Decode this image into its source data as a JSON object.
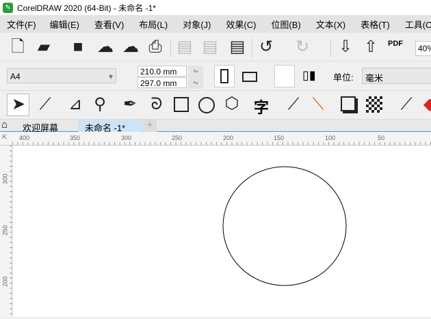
{
  "window": {
    "title": "CorelDRAW 2020 (64-Bit) - 未命名 -1*"
  },
  "menu": [
    "文件(F)",
    "编辑(E)",
    "查看(V)",
    "布局(L)",
    "对象(J)",
    "效果(C)",
    "位图(B)",
    "文本(X)",
    "表格(T)",
    "工具(O)"
  ],
  "toolbar": {
    "zoom": "40%",
    "pdf": "PDF"
  },
  "property_bar": {
    "page_size": "A4",
    "width": "210.0 mm",
    "height": "297.0 mm",
    "units_label": "单位:",
    "units": "毫米"
  },
  "toolbox": {
    "text_tool": "字"
  },
  "tabs": [
    {
      "label": "欢迎屏幕"
    },
    {
      "label": "未命名 -1*",
      "active": true
    }
  ],
  "ruler": {
    "h": [
      "400",
      "350",
      "300",
      "250",
      "200",
      "150",
      "100",
      "50"
    ],
    "v": [
      "300",
      "250",
      "200"
    ]
  }
}
